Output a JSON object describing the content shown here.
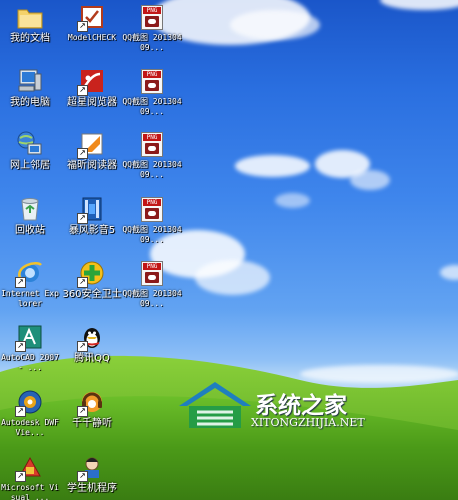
{
  "desktop": {
    "icons_col1": [
      {
        "label": "我的文档",
        "icon": "folder-icon"
      },
      {
        "label": "我的电脑",
        "icon": "computer-icon"
      },
      {
        "label": "网上邻居",
        "icon": "network-icon"
      },
      {
        "label": "回收站",
        "icon": "recycle-bin-icon"
      },
      {
        "label": "Internet Explorer",
        "icon": "ie-icon"
      },
      {
        "label": "AutoCAD 2007 - ...",
        "icon": "autocad-icon"
      },
      {
        "label": "Autodesk DWF Vie...",
        "icon": "dwf-viewer-icon"
      },
      {
        "label": "Microsoft Visual ...",
        "icon": "visual-studio-icon"
      }
    ],
    "icons_col2": [
      {
        "label": "ModelCHECK",
        "icon": "modelcheck-icon"
      },
      {
        "label": "超星阅览器",
        "icon": "ssreader-icon"
      },
      {
        "label": "福昕阅读器",
        "icon": "foxit-reader-icon"
      },
      {
        "label": "暴风影音5",
        "icon": "baofeng-icon"
      },
      {
        "label": "360安全卫士",
        "icon": "360-safe-icon"
      },
      {
        "label": "腾讯QQ",
        "icon": "qq-icon"
      },
      {
        "label": "千千静听",
        "icon": "ttplayer-icon"
      },
      {
        "label": "学生机程序",
        "icon": "student-program-icon"
      }
    ],
    "icons_col3": [
      {
        "label": "QQ截图 20130409...",
        "icon": "png-file-icon"
      },
      {
        "label": "QQ截图 20130409...",
        "icon": "png-file-icon"
      },
      {
        "label": "QQ截图 20130409...",
        "icon": "png-file-icon"
      },
      {
        "label": "QQ截图 20130409...",
        "icon": "png-file-icon"
      },
      {
        "label": "QQ截图 20130409...",
        "icon": "png-file-icon"
      }
    ],
    "png_tag": "PNG",
    "shortcut_arrow": "↗"
  },
  "watermark": {
    "title": "系统之家",
    "url": "XITONGZHIJIA.NET",
    "logo": "house-logo"
  },
  "colors": {
    "sky_top": "#1a56c9",
    "grass": "#4a9a1a",
    "label_text": "#ffffff"
  }
}
